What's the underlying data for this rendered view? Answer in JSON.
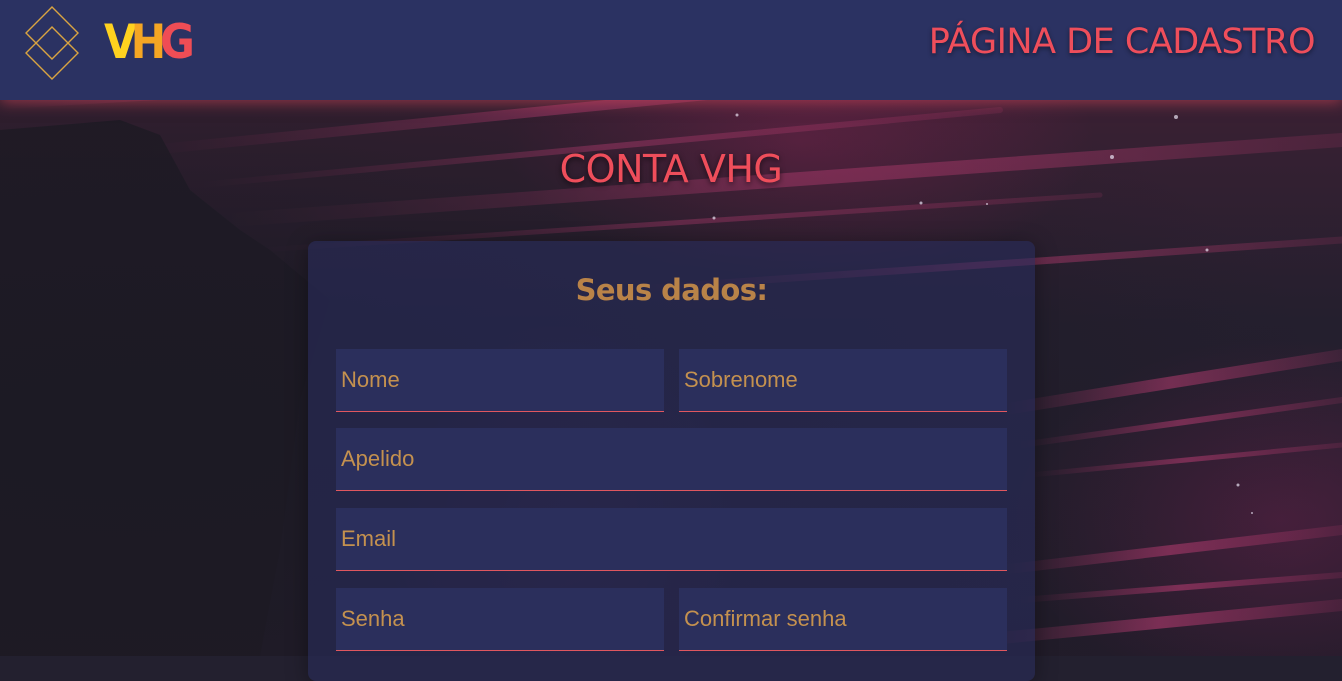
{
  "header": {
    "brand": {
      "letters": [
        {
          "char": "V",
          "color": "#ffd21f"
        },
        {
          "char": "H",
          "color": "#f5a623"
        },
        {
          "char": "G",
          "color": "#ef4d55"
        }
      ],
      "logo_icon": "double-diamond-icon"
    },
    "page_heading": "PÁGINA DE CADASTRO"
  },
  "main": {
    "title": "CONTA VHG",
    "form": {
      "heading": "Seus dados:",
      "fields": {
        "nome": {
          "placeholder": "Nome",
          "value": ""
        },
        "sobrenome": {
          "placeholder": "Sobrenome",
          "value": ""
        },
        "apelido": {
          "placeholder": "Apelido",
          "value": ""
        },
        "email": {
          "placeholder": "Email",
          "value": ""
        },
        "senha": {
          "placeholder": "Senha",
          "value": ""
        },
        "confirmar_senha": {
          "placeholder": "Confirmar senha",
          "value": ""
        }
      }
    }
  },
  "colors": {
    "header_bg": "#2b3262",
    "accent_red": "#ef4e5b",
    "gold_text": "#c4914f",
    "field_bg": "#2b2f5c",
    "logo_outline": "#d9a441"
  }
}
